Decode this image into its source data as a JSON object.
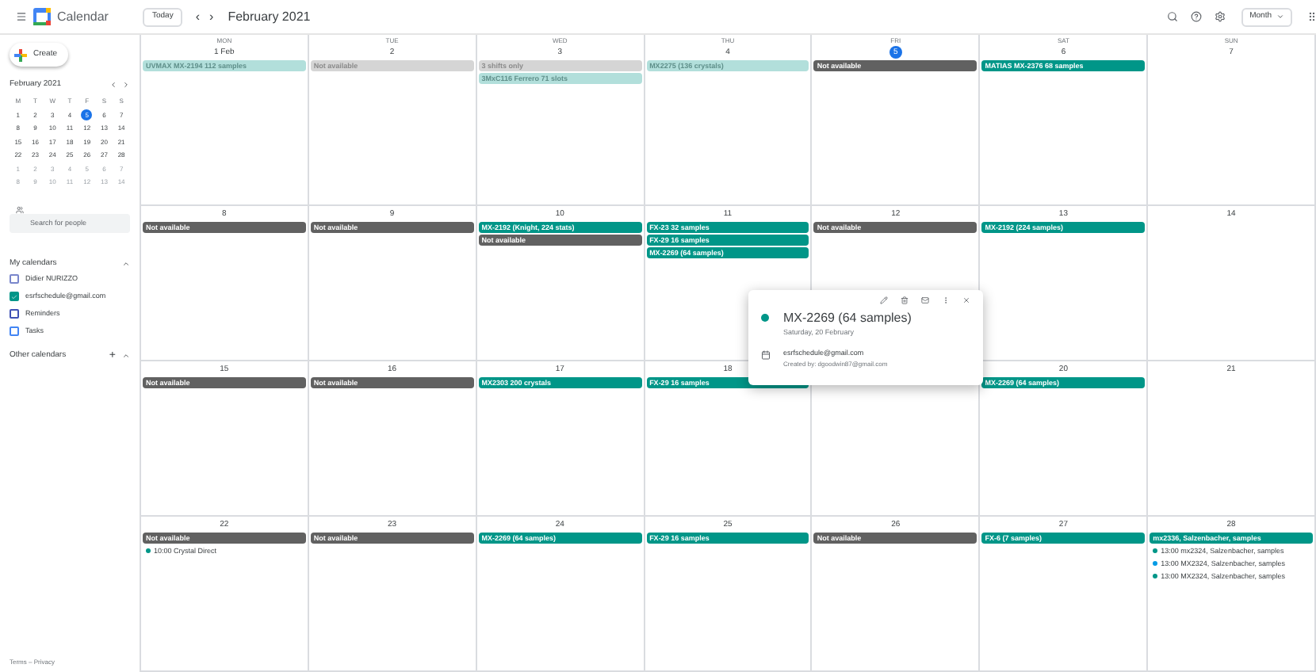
{
  "app": {
    "title": "Calendar"
  },
  "toolbar": {
    "today": "Today",
    "prev": "‹",
    "next": "›",
    "title": "February 2021",
    "view": "Month"
  },
  "sidebar": {
    "create": "Create",
    "mini_calendar": {
      "title": "February 2021",
      "weekdays": [
        "M",
        "T",
        "W",
        "T",
        "F",
        "S",
        "S"
      ],
      "weeks": [
        [
          {
            "d": "1",
            "outside": false,
            "today": false
          },
          {
            "d": "2",
            "outside": false,
            "today": false
          },
          {
            "d": "3",
            "outside": false,
            "today": false
          },
          {
            "d": "4",
            "outside": false,
            "today": false
          },
          {
            "d": "5",
            "outside": false,
            "today": true
          },
          {
            "d": "6",
            "outside": false,
            "today": false
          },
          {
            "d": "7",
            "outside": false,
            "today": false
          }
        ],
        [
          {
            "d": "8",
            "outside": false,
            "today": false
          },
          {
            "d": "9",
            "outside": false,
            "today": false
          },
          {
            "d": "10",
            "outside": false,
            "today": false
          },
          {
            "d": "11",
            "outside": false,
            "today": false
          },
          {
            "d": "12",
            "outside": false,
            "today": false
          },
          {
            "d": "13",
            "outside": false,
            "today": false
          },
          {
            "d": "14",
            "outside": false,
            "today": false
          }
        ],
        [
          {
            "d": "15",
            "outside": false,
            "today": false
          },
          {
            "d": "16",
            "outside": false,
            "today": false
          },
          {
            "d": "17",
            "outside": false,
            "today": false
          },
          {
            "d": "18",
            "outside": false,
            "today": false
          },
          {
            "d": "19",
            "outside": false,
            "today": false
          },
          {
            "d": "20",
            "outside": false,
            "today": false
          },
          {
            "d": "21",
            "outside": false,
            "today": false
          }
        ],
        [
          {
            "d": "22",
            "outside": false,
            "today": false
          },
          {
            "d": "23",
            "outside": false,
            "today": false
          },
          {
            "d": "24",
            "outside": false,
            "today": false
          },
          {
            "d": "25",
            "outside": false,
            "today": false
          },
          {
            "d": "26",
            "outside": false,
            "today": false
          },
          {
            "d": "27",
            "outside": false,
            "today": false
          },
          {
            "d": "28",
            "outside": false,
            "today": false
          }
        ],
        [
          {
            "d": "1",
            "outside": true,
            "today": false
          },
          {
            "d": "2",
            "outside": true,
            "today": false
          },
          {
            "d": "3",
            "outside": true,
            "today": false
          },
          {
            "d": "4",
            "outside": true,
            "today": false
          },
          {
            "d": "5",
            "outside": true,
            "today": false
          },
          {
            "d": "6",
            "outside": true,
            "today": false
          },
          {
            "d": "7",
            "outside": true,
            "today": false
          }
        ],
        [
          {
            "d": "8",
            "outside": true,
            "today": false
          },
          {
            "d": "9",
            "outside": true,
            "today": false
          },
          {
            "d": "10",
            "outside": true,
            "today": false
          },
          {
            "d": "11",
            "outside": true,
            "today": false
          },
          {
            "d": "12",
            "outside": true,
            "today": false
          },
          {
            "d": "13",
            "outside": true,
            "today": false
          },
          {
            "d": "14",
            "outside": true,
            "today": false
          }
        ]
      ]
    },
    "search": {
      "placeholder": "Search for people"
    },
    "my_calendars": {
      "title": "My calendars",
      "items": [
        {
          "label": "Didier NURIZZO",
          "checked": false,
          "color": "#7986cb"
        },
        {
          "label": "esrfschedule@gmail.com",
          "checked": true,
          "color": "#009688"
        },
        {
          "label": "Reminders",
          "checked": false,
          "color": "#3f51b5"
        },
        {
          "label": "Tasks",
          "checked": false,
          "color": "#4285f4"
        }
      ]
    },
    "other_calendars": {
      "title": "Other calendars",
      "add": "+"
    },
    "footer": "Terms – Privacy"
  },
  "weeks": [
    {
      "days": [
        {
          "weekday": "MON",
          "date": "1 Feb",
          "today": false,
          "events": [
            {
              "kind": "booking",
              "title": "UVMAX MX-2194 112 samples",
              "past": true
            }
          ]
        },
        {
          "weekday": "TUE",
          "date": "2",
          "today": false,
          "events": [
            {
              "kind": "unavailable",
              "title": "Not available",
              "past": true
            }
          ]
        },
        {
          "weekday": "WED",
          "date": "3",
          "today": false,
          "events": [
            {
              "kind": "unavailable",
              "title": "3 shifts only",
              "past": true
            },
            {
              "kind": "booking",
              "title": "3MxC116 Ferrero 71 slots",
              "past": true
            }
          ]
        },
        {
          "weekday": "THU",
          "date": "4",
          "today": false,
          "events": [
            {
              "kind": "booking",
              "title": "MX2275 (136 crystals)",
              "past": true
            }
          ]
        },
        {
          "weekday": "FRI",
          "date": "5",
          "today": true,
          "events": [
            {
              "kind": "unavailable",
              "title": "Not available",
              "past": false
            }
          ]
        },
        {
          "weekday": "SAT",
          "date": "6",
          "today": false,
          "events": [
            {
              "kind": "booking",
              "title": "MATIAS MX-2376 68 samples",
              "past": false
            }
          ]
        },
        {
          "weekday": "SUN",
          "date": "7",
          "today": false
        }
      ]
    },
    {
      "days": [
        {
          "date": "8",
          "today": false,
          "events": [
            {
              "kind": "unavailable",
              "title": "Not available",
              "past": false
            }
          ]
        },
        {
          "date": "9",
          "today": false,
          "events": [
            {
              "kind": "unavailable",
              "title": "Not available",
              "past": false
            }
          ]
        },
        {
          "date": "10",
          "today": false,
          "events": [
            {
              "kind": "booking",
              "title": "MX-2192 (Knight, 224 stats)",
              "past": false
            },
            {
              "kind": "unavailable",
              "title": "Not available",
              "past": false
            }
          ]
        },
        {
          "date": "11",
          "today": false,
          "events": [
            {
              "kind": "booking",
              "title": "FX-23 32 samples",
              "past": false
            },
            {
              "kind": "booking",
              "title": "FX-29 16 samples",
              "past": false
            },
            {
              "kind": "booking",
              "title": "MX-2269 (64 samples)",
              "past": false
            }
          ]
        },
        {
          "date": "12",
          "today": false,
          "events": [
            {
              "kind": "unavailable",
              "title": "Not available",
              "past": false
            }
          ]
        },
        {
          "date": "13",
          "today": false,
          "events": [
            {
              "kind": "booking",
              "title": "MX-2192 (224 samples)",
              "past": false
            }
          ]
        },
        {
          "date": "14",
          "today": false
        }
      ]
    },
    {
      "days": [
        {
          "date": "15",
          "today": false,
          "events": [
            {
              "kind": "unavailable",
              "title": "Not available",
              "past": false
            }
          ]
        },
        {
          "date": "16",
          "today": false,
          "events": [
            {
              "kind": "unavailable",
              "title": "Not available",
              "past": false
            }
          ]
        },
        {
          "date": "17",
          "today": false,
          "events": [
            {
              "kind": "booking",
              "title": "MX2303 200 crystals",
              "past": false
            }
          ]
        },
        {
          "date": "18",
          "today": false,
          "events": [
            {
              "kind": "booking",
              "title": "FX-29 16 samples",
              "past": false
            }
          ]
        },
        {
          "covered": true
        },
        {
          "date": "20",
          "today": false,
          "events": [
            {
              "kind": "booking",
              "title": "MX-2269 (64 samples)",
              "past": false
            }
          ]
        },
        {
          "date": "21",
          "today": false
        }
      ]
    },
    {
      "days": [
        {
          "date": "22",
          "today": false,
          "events": [
            {
              "kind": "unavailable",
              "title": "Not available",
              "past": false
            },
            {
              "kind": "timed",
              "time": "10:00",
              "title": "Crystal Direct",
              "color": "#009688"
            }
          ]
        },
        {
          "date": "23",
          "today": false,
          "events": [
            {
              "kind": "unavailable",
              "title": "Not available",
              "past": false
            }
          ]
        },
        {
          "date": "24",
          "today": false,
          "events": [
            {
              "kind": "booking",
              "title": "MX-2269 (64 samples)",
              "past": false
            }
          ]
        },
        {
          "date": "25",
          "today": false,
          "events": [
            {
              "kind": "booking",
              "title": "FX-29 16 samples",
              "past": false
            }
          ]
        },
        {
          "date": "26",
          "today": false,
          "events": [
            {
              "kind": "unavailable",
              "title": "Not available",
              "past": false
            }
          ]
        },
        {
          "date": "27",
          "today": false,
          "events": [
            {
              "kind": "booking",
              "title": "FX-6 (7 samples)",
              "past": false
            }
          ]
        },
        {
          "date": "28",
          "today": false,
          "events": [
            {
              "kind": "booking",
              "title": "mx2336, Salzenbacher, samples",
              "past": false
            },
            {
              "kind": "timed",
              "time": "13:00",
              "title": "mx2324, Salzenbacher, samples",
              "color": "#009688"
            },
            {
              "kind": "timed",
              "time": "13:00",
              "title": "MX2324, Salzenbacher, samples",
              "color": "#039be5"
            },
            {
              "kind": "timed",
              "time": "13:00",
              "title": "MX2324, Salzenbacher, samples",
              "color": "#009688"
            }
          ]
        }
      ]
    }
  ],
  "popup": {
    "title": "MX-2269 (64 samples)",
    "color": "#009688",
    "date": "Saturday, 20 February",
    "calendar": "esrfschedule@gmail.com",
    "created_by": "Created by: dgoodwin87@gmail.com"
  }
}
